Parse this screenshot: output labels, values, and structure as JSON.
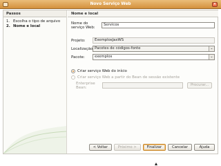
{
  "window": {
    "title": "Novo Serviço Web"
  },
  "steps": {
    "header": "Passos",
    "items": [
      {
        "num": "1.",
        "label": "Escolha o tipo de arquivo"
      },
      {
        "num": "2.",
        "label": "Nome e local"
      }
    ]
  },
  "panel": {
    "header": "Nome e local",
    "service_name": {
      "label": "Nome do serviço Web:",
      "value": "Servicos"
    },
    "project": {
      "label": "Projeto:",
      "value": "ExemplosJaxWS"
    },
    "location": {
      "label": "Localização:",
      "value": "Pacotes de códigos-fonte"
    },
    "package": {
      "label": "Pacote:",
      "value": "exemplos"
    },
    "radio_from_scratch": "Criar serviço Web do início",
    "radio_from_bean": "Criar serviço Web a partir do Bean de sessão existente",
    "enterprise_bean": {
      "label": "Enterprise Bean:",
      "value": "",
      "browse": "Procurar..."
    }
  },
  "buttons": {
    "back": "< Voltar",
    "next": "Próximo >",
    "finish": "Finalizar",
    "cancel": "Cancelar",
    "help": "Ajuda"
  },
  "colors": {
    "titlebar": "#d4913d",
    "accent": "#d98b2b"
  }
}
